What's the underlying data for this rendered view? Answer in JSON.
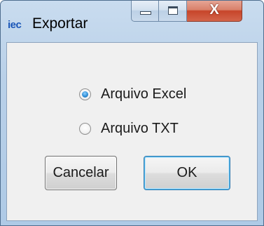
{
  "window": {
    "title": "Exportar",
    "app_icon_text": "iec",
    "caption_buttons": {
      "minimize_icon": "minimize-icon",
      "maximize_icon": "maximize-icon",
      "close_glyph": "X"
    }
  },
  "export_options": [
    {
      "label": "Arquivo Excel",
      "selected": true
    },
    {
      "label": "Arquivo TXT",
      "selected": false
    }
  ],
  "buttons": {
    "cancel_label": "Cancelar",
    "ok_label": "OK"
  },
  "colors": {
    "accent": "#2f8fd6",
    "close_button": "#c7452a",
    "app_icon": "#1a56b8"
  }
}
